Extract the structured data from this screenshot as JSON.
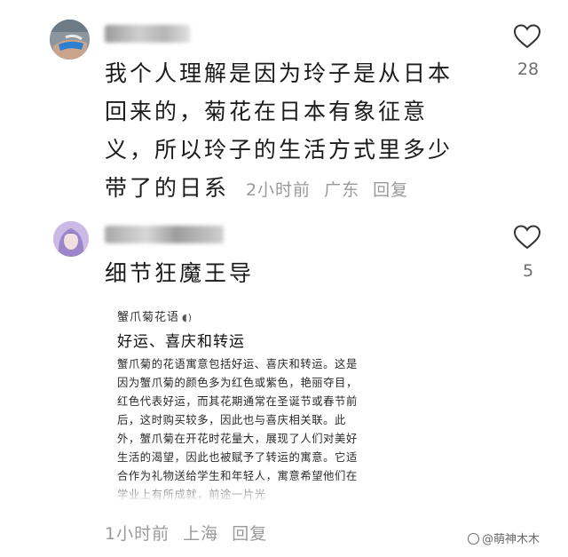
{
  "comments": [
    {
      "text": "我个人理解是因为玲子是从日本回来的，菊花在日本有象征意义，所以玲子的生活方式里多少带了的日系",
      "time": "2小时前",
      "location": "广东",
      "reply_label": "回复",
      "likes": "28",
      "avatar_icon": "user-avatar",
      "like_icon": "heart-outline-icon"
    },
    {
      "text": "细节狂魔王导",
      "time": "1小时前",
      "location": "上海",
      "reply_label": "回复",
      "likes": "5",
      "avatar_icon": "user-avatar",
      "like_icon": "heart-outline-icon",
      "attachment": {
        "source": "蟹爪菊花语",
        "title": "好运、喜庆和转运",
        "body": "蟹爪菊的花语寓意包括好运、喜庆和转运。这是因为蟹爪菊的颜色多为红色或紫色，艳丽夺目，红色代表好运，而其花期通常在圣诞节或春节前后，这时购买较多，因此也与喜庆相关联。此外，蟹爪菊在开花时花量大，展现了人们对美好生活的渴望，因此也被赋予了转运的寓意。它适合作为礼物送给学生和年轻人，寓意希望他们在学业上有所成就，前途一片光"
      }
    }
  ],
  "watermark": {
    "text": "@萌神木木",
    "icon": "watermark-logo-icon"
  },
  "colors": {
    "text": "#1b1b1b",
    "meta": "#9a9a9a",
    "count": "#6e6e6e"
  }
}
